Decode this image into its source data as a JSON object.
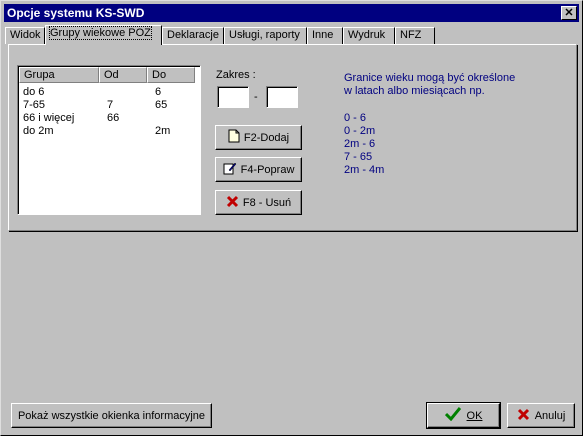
{
  "window": {
    "title": "Opcje systemu KS-SWD",
    "close_label": "✕"
  },
  "tabs": [
    {
      "label": "Widok"
    },
    {
      "label": "Grupy wiekowe POZ"
    },
    {
      "label": "Deklaracje"
    },
    {
      "label": "Usługi, raporty"
    },
    {
      "label": "Inne"
    },
    {
      "label": "Wydruk"
    },
    {
      "label": "NFZ"
    }
  ],
  "list": {
    "columns": [
      "Grupa",
      "Od",
      "Do"
    ],
    "rows": [
      [
        "do 6",
        "",
        "6"
      ],
      [
        "7-65",
        "7",
        "65"
      ],
      [
        "66 i więcej",
        "66",
        ""
      ],
      [
        "do 2m",
        "",
        "2m"
      ]
    ]
  },
  "range": {
    "label": "Zakres :",
    "separator": "-",
    "from_value": "",
    "to_value": ""
  },
  "buttons": {
    "add": "F2-Dodaj",
    "edit": "F4-Popraw",
    "delete": "F8 - Usuń"
  },
  "info": {
    "line1": "Granice wieku mogą być określone",
    "line2": "w latach albo miesiącach np.",
    "examples": [
      "0    - 6",
      "0    - 2m",
      "2m - 6",
      "7    - 65",
      "2m - 4m"
    ]
  },
  "footer": {
    "show_all": "Pokaż wszystkie okienka informacyjne",
    "ok": "OK",
    "cancel": "Anuluj"
  },
  "colors": {
    "title_bar": "#000080",
    "info_text": "#000080",
    "ok_check": "#008000",
    "cancel_x": "#c00000"
  }
}
